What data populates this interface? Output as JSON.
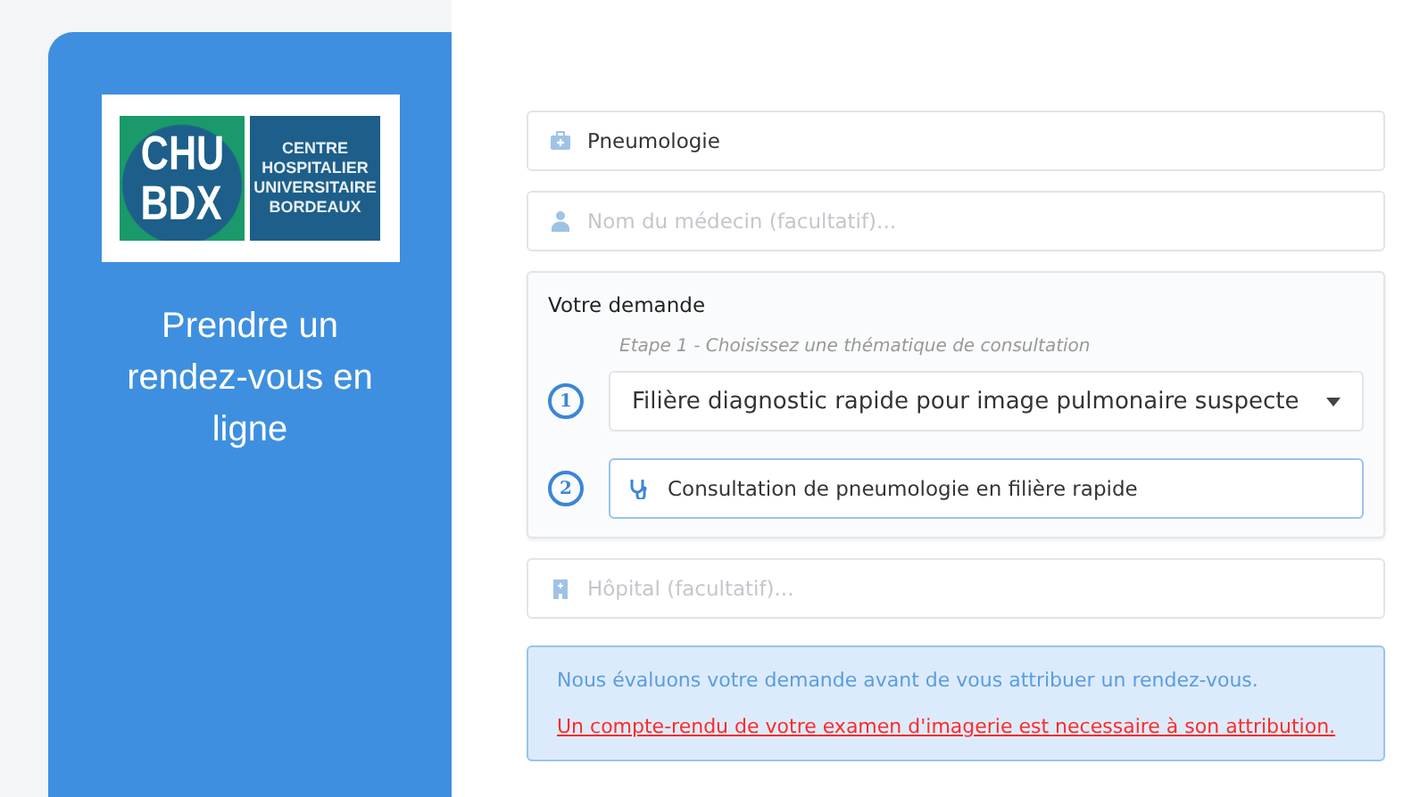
{
  "sidebar": {
    "logo": {
      "mark_lines": [
        "CHU",
        "BDX"
      ],
      "name_lines": [
        "CENTRE",
        "HOSPITALIER",
        "UNIVERSITAIRE",
        "BORDEAUX"
      ]
    },
    "heading": "Prendre un rendez-vous en ligne"
  },
  "specialty_field": {
    "value": "Pneumologie"
  },
  "doctor_field": {
    "placeholder": "Nom du médecin (facultatif)..."
  },
  "request": {
    "title": "Votre demande",
    "step_hint": "Etape 1 - Choisissez une thématique de consultation",
    "steps": [
      {
        "number": "1",
        "kind": "dropdown",
        "value": "Filière diagnostic rapide pour image pulmonaire suspecte"
      },
      {
        "number": "2",
        "kind": "option",
        "value": "Consultation de pneumologie en filière rapide"
      }
    ]
  },
  "hospital_field": {
    "placeholder": "Hôpital (facultatif)..."
  },
  "notice": {
    "info": "Nous évaluons votre demande avant de vous attribuer un rendez-vous.",
    "warning": "Un compte-rendu de votre examen d'imagerie est necessaire à son attribution."
  }
}
